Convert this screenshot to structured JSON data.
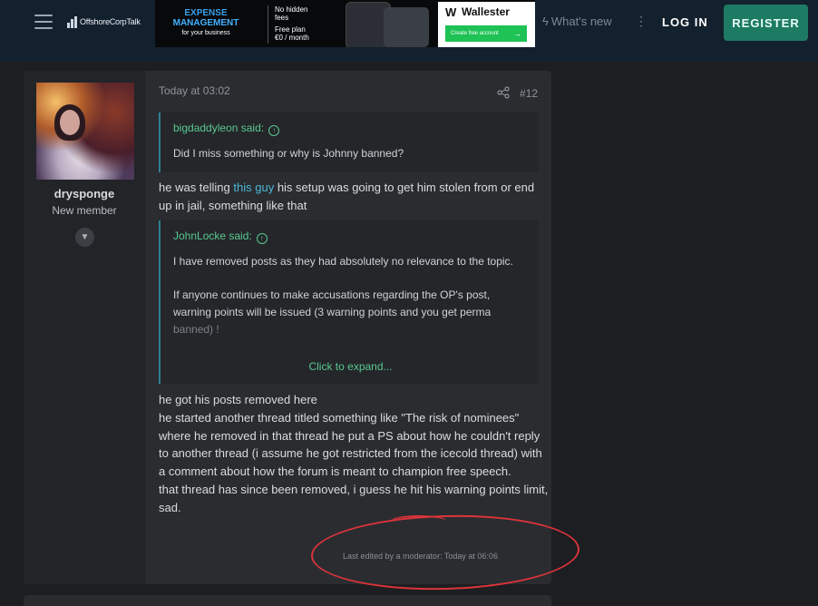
{
  "topbar": {
    "logo_text": "OffshoreCorpTalk",
    "whats_new": "What's new",
    "login": "LOG IN",
    "register": "REGISTER",
    "colors": {
      "bar": "#13202e",
      "register_bg": "#1d7a63"
    }
  },
  "ad": {
    "expense_l1": "EXPENSE",
    "expense_l2": "MANAGEMENT",
    "expense_l3": "for your business",
    "feature1_l1": "No hidden",
    "feature1_l2": "fees",
    "feature2_l1": "Free plan",
    "feature2_l2": "€0 / month",
    "brand": "Wallester",
    "cta": "Create free account"
  },
  "post": {
    "user": {
      "name": "drysponge",
      "title": "New member"
    },
    "date": "Today at 03:02",
    "number": "#12",
    "quote1": {
      "author": "bigdaddyleon said:",
      "text": "Did I miss something or why is Johnny banned?"
    },
    "reply1_pre": "he was telling ",
    "reply1_link": "this guy",
    "reply1_post": " his setup was going to get him stolen from or end up in jail, something like that",
    "quote2": {
      "author": "JohnLocke said:",
      "p1": "I have removed posts as they had absolutely no relevance to the topic.",
      "p2": "If anyone continues to make accusations regarding the OP's post, warning points will be issued (3 warning points and you get perma",
      "p2_fade": "banned) !",
      "expand": "Click to expand..."
    },
    "body_lines": [
      "he got his posts removed here",
      "he started another thread titled something like \"The risk of nominees\" where he removed in that thread he put a PS about how he couldn't reply to another thread (i assume he got restricted from the icecold thread) with a comment about how the forum is meant to champion free speech.",
      "that thread has since been removed, i guess he hit his warning points limit, sad."
    ],
    "edited_note": "Last edited by a moderator: Today at 06:06"
  },
  "icons": [
    "menu-icon",
    "bolt-icon",
    "more-vertical-icon",
    "share-icon",
    "chevron-down-icon",
    "arrow-up-circle-icon"
  ],
  "annotation_color": "#d9343a"
}
